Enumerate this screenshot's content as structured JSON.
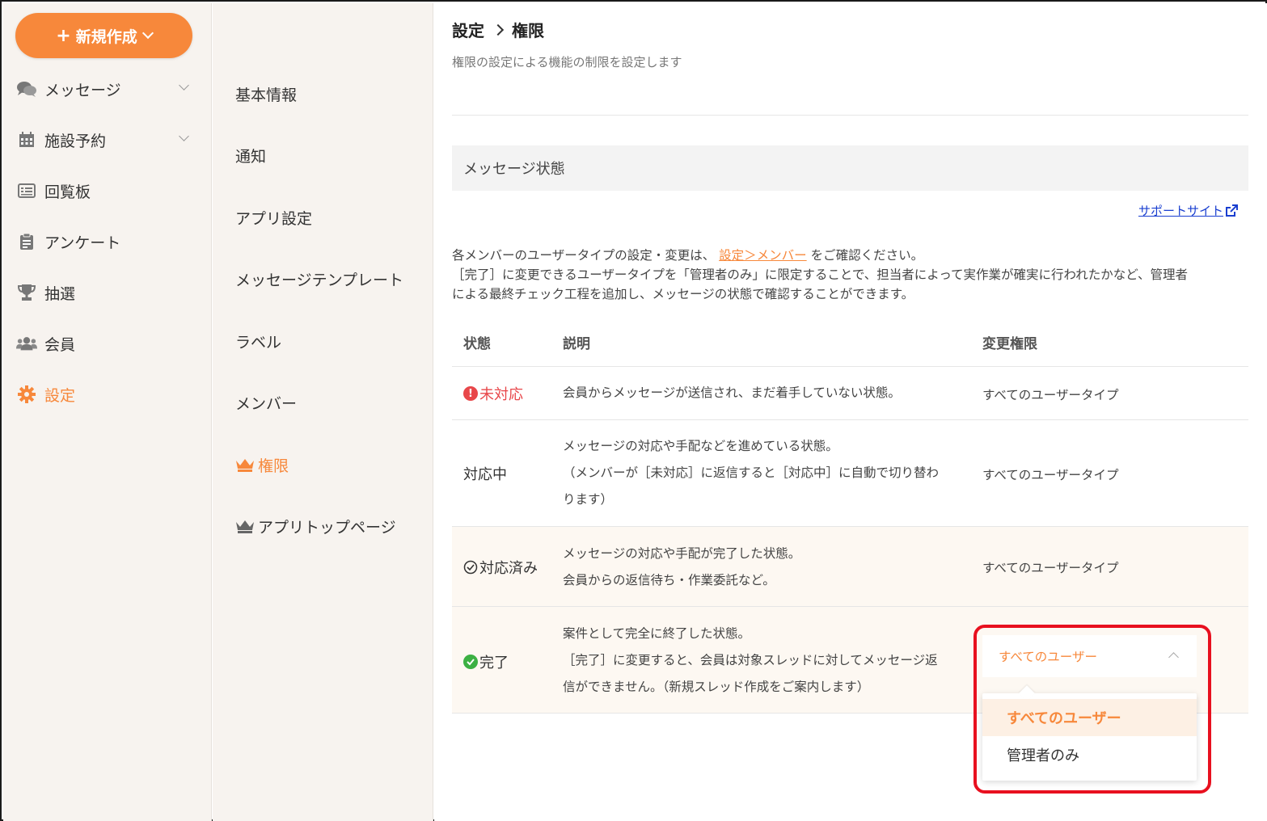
{
  "header": {
    "new_button": "新規作成",
    "breadcrumb_parent": "設定",
    "breadcrumb_current": "権限",
    "subtitle": "権限の設定による機能の制限を設定します"
  },
  "sidebar": {
    "items": [
      {
        "label": "メッセージ",
        "icon": "chat-icon"
      },
      {
        "label": "施設予約",
        "icon": "calendar-icon"
      },
      {
        "label": "回覧板",
        "icon": "board-icon"
      },
      {
        "label": "アンケート",
        "icon": "clipboard-icon"
      },
      {
        "label": "抽選",
        "icon": "trophy-icon"
      },
      {
        "label": "会員",
        "icon": "users-icon"
      },
      {
        "label": "設定",
        "icon": "gear-icon",
        "active": true
      }
    ]
  },
  "subnav": {
    "items": [
      {
        "label": "基本情報"
      },
      {
        "label": "通知"
      },
      {
        "label": "アプリ設定"
      },
      {
        "label": "メッセージテンプレート"
      },
      {
        "label": "ラベル"
      },
      {
        "label": "メンバー"
      },
      {
        "label": "権限",
        "active": true
      },
      {
        "label": "アプリトップページ"
      }
    ]
  },
  "section": {
    "title": "メッセージ状態",
    "support_link": "サポートサイト",
    "desc_line1_pre": "各メンバーのユーザータイプの設定・変更は、",
    "desc_line1_link": "設定＞メンバー",
    "desc_line1_post": "をご確認ください。",
    "desc_line2": "［完了］に変更できるユーザータイプを「管理者のみ」に限定することで、担当者によって実作業が確実に行われたかなど、管理者",
    "desc_line3": "による最終チェック工程を追加し、メッセージの状態で確認することができます。"
  },
  "table": {
    "headers": {
      "status": "状態",
      "description": "説明",
      "permission": "変更権限"
    },
    "rows": [
      {
        "status": "未対応",
        "desc": [
          "会員からメッセージが送信され、まだ着手していない状態。"
        ],
        "perm": "すべてのユーザータイプ"
      },
      {
        "status": "対応中",
        "desc": [
          "メッセージの対応や手配などを進めている状態。",
          "（メンバーが［未対応］に返信すると［対応中］に自動で切り替わ",
          "ります）"
        ],
        "perm": "すべてのユーザータイプ"
      },
      {
        "status": "対応済み",
        "desc": [
          "メッセージの対応や手配が完了した状態。",
          "会員からの返信待ち・作業委託など。"
        ],
        "perm": "すべてのユーザータイプ"
      },
      {
        "status": "完了",
        "desc": [
          "案件として完全に終了した状態。",
          "［完了］に変更すると、会員は対象スレッドに対してメッセージ返",
          "信ができません。（新規スレッド作成をご案内します）"
        ],
        "perm": ""
      }
    ]
  },
  "dropdown": {
    "selected_value": "すべてのユーザー",
    "options": [
      "すべてのユーザー",
      "管理者のみ"
    ]
  },
  "colors": {
    "accent": "#f7883b",
    "highlight": "#e8101f",
    "unhandled": "#e8474a",
    "complete": "#3cb043"
  }
}
